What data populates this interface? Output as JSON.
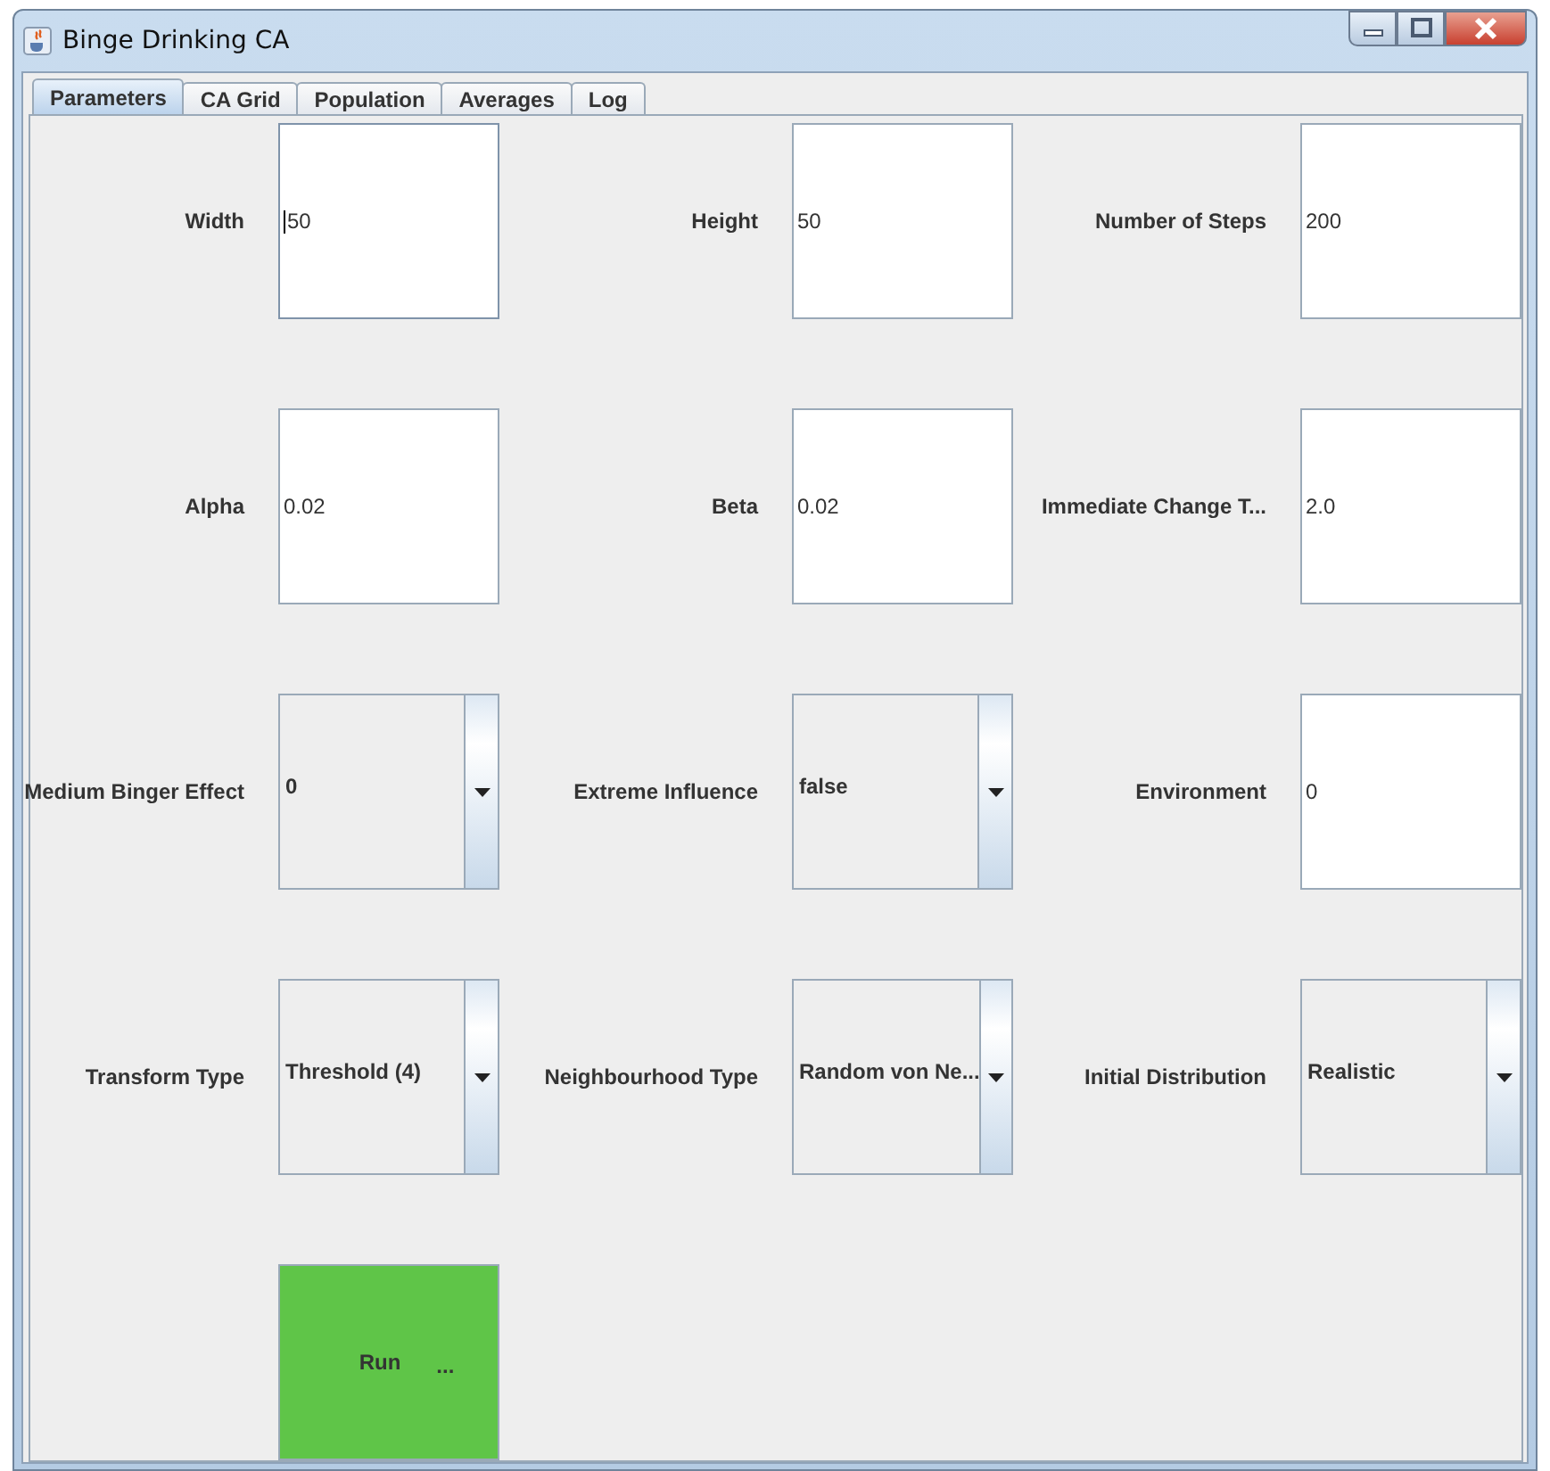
{
  "window": {
    "title": "Binge Drinking CA"
  },
  "tabs": [
    {
      "label": "Parameters",
      "selected": true
    },
    {
      "label": "CA Grid",
      "selected": false
    },
    {
      "label": "Population",
      "selected": false
    },
    {
      "label": "Averages",
      "selected": false
    },
    {
      "label": "Log",
      "selected": false
    }
  ],
  "parameters": [
    {
      "label": "Width",
      "kind": "text",
      "value": "50",
      "focused": true
    },
    {
      "label": "Height",
      "kind": "text",
      "value": "50",
      "focused": false
    },
    {
      "label": "Number of Steps",
      "kind": "text",
      "value": "200",
      "focused": false
    },
    {
      "label": "Alpha",
      "kind": "text",
      "value": "0.02",
      "focused": false
    },
    {
      "label": "Beta",
      "kind": "text",
      "value": "0.02",
      "focused": false
    },
    {
      "label": "Immediate Change T...",
      "kind": "text",
      "value": "2.0",
      "focused": false
    },
    {
      "label": "Medium Binger Effect",
      "kind": "combo",
      "value": "0"
    },
    {
      "label": "Extreme Influence",
      "kind": "combo",
      "value": "false"
    },
    {
      "label": "Environment",
      "kind": "text",
      "value": "0",
      "focused": false
    },
    {
      "label": "Transform Type",
      "kind": "combo",
      "value": "Threshold (4)"
    },
    {
      "label": "Neighbourhood Type",
      "kind": "combo",
      "value": "Random von Ne..."
    },
    {
      "label": "Initial Distribution",
      "kind": "combo",
      "value": "Realistic"
    }
  ],
  "run_button": {
    "label": "Run",
    "suffix": "..."
  }
}
